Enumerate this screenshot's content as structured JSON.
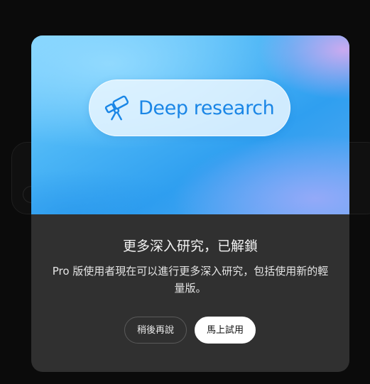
{
  "hero": {
    "badge_label": "Deep research",
    "badge_icon": "telescope-icon",
    "accent_color": "#1a86e6"
  },
  "dialog": {
    "title": "更多深入研究，已解鎖",
    "description": "Pro 版使用者現在可以進行更多深入研究，包括使用新的輕量版。",
    "later_button": "稍後再說",
    "try_button": "馬上試用"
  }
}
